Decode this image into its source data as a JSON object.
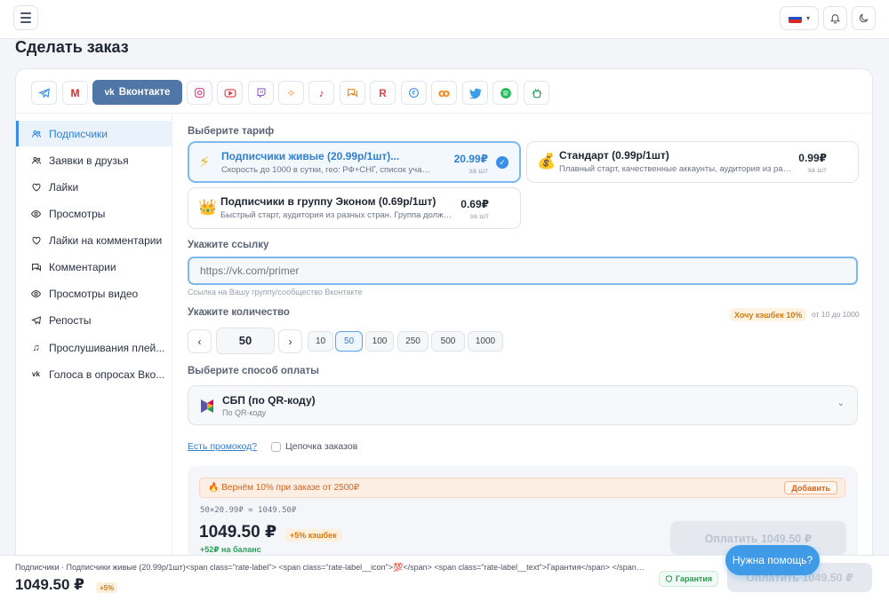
{
  "page": {
    "title": "Сделать заказ"
  },
  "header": {
    "language": "ru",
    "icons": [
      "menu-icon",
      "bell-icon",
      "moon-icon"
    ]
  },
  "platforms": {
    "active_label": "Вконтакте",
    "items": [
      "telegram",
      "gmail",
      "vkontakte",
      "instagram",
      "youtube",
      "twitch",
      "sparkle",
      "tiktok",
      "chat",
      "rutube",
      "threads",
      "odnoklassniki",
      "twitter",
      "spotify",
      "telegram-bot"
    ]
  },
  "sidebar": {
    "items": [
      {
        "label": "Подписчики",
        "icon": "users-icon",
        "active": true
      },
      {
        "label": "Заявки в друзья",
        "icon": "friends-icon"
      },
      {
        "label": "Лайки",
        "icon": "heart-icon"
      },
      {
        "label": "Просмотры",
        "icon": "eye-icon"
      },
      {
        "label": "Лайки на комментарии",
        "icon": "heart-icon"
      },
      {
        "label": "Комментарии",
        "icon": "comment-icon"
      },
      {
        "label": "Просмотры видео",
        "icon": "eye-icon"
      },
      {
        "label": "Репосты",
        "icon": "send-icon"
      },
      {
        "label": "Прослушивания плей...",
        "icon": "music-icon"
      },
      {
        "label": "Голоса в опросах Вко...",
        "icon": "vk-icon"
      }
    ]
  },
  "tariffs": {
    "label": "Выберите тариф",
    "items": [
      {
        "title": "Подписчики живые (20.99р/1шт)...",
        "desc": "Скорость до 1000 в сутки, гео: РФ+СНГ, список участник...",
        "price": "20.99₽",
        "unit": "за шт",
        "icon": "⚡",
        "selected": true
      },
      {
        "title": "Стандарт (0.99р/1шт)",
        "desc": "Плавный старт, качественные аккаунты, аудитория из раз...",
        "price": "0.99₽",
        "unit": "за шт",
        "icon": "💰"
      },
      {
        "title": "Подписчики в группу Эконом (0.69р/1шт)",
        "desc": "Быстрый старт, аудитория из разных стран. Группа должн...",
        "price": "0.69₽",
        "unit": "за шт",
        "icon": "👑"
      }
    ]
  },
  "link": {
    "label": "Укажите ссылку",
    "placeholder": "https://vk.com/primer",
    "hint": "Ссылка на Вашу группу/сообщество Вконтакте"
  },
  "quantity": {
    "label": "Укажите количество",
    "cashback_badge": "Хочу кэшбек 10%",
    "range": "от 10 до 1000",
    "value": "50",
    "dec": "‹",
    "inc": "›",
    "presets": [
      "10",
      "50",
      "100",
      "250",
      "500",
      "1000"
    ],
    "active_preset": "50"
  },
  "payment": {
    "label": "Выберите способ оплаты",
    "method": "СБП (по QR-коду)",
    "sub": "По QR-коду"
  },
  "promo": {
    "link": "Есть промокод?",
    "chain": "Цепочка заказов"
  },
  "summary": {
    "banner": "🔥 Вернём 10% при заказе от 2500₽",
    "banner_button": "Добавить",
    "formula": "50×20.99₽ = 1049.50₽",
    "total": "1049.50 ₽",
    "cashback": "+5% кэшбек",
    "bonus": "+52₽ на баланс",
    "pay_button": "Оплатить 1049.50 ₽"
  },
  "bottombar": {
    "text": "Подписчики · Подписчики живые (20.99р/1шт)<span class=\"rate-label\"> <span class=\"rate-label__icon\">💯</span> <span class=\"rate-label__text\">Гарантия</span> </span> · за шт",
    "total": "1049.50 ₽",
    "cashback": "+5%",
    "guarantee": "Гарантия",
    "pay_button": "Оплатить 1049.50 ₽"
  },
  "help": {
    "label": "Нужна помощь?"
  },
  "colors": {
    "accent": "#3a8ee6",
    "vk": "#4f76a6",
    "orange": "#d0651d",
    "green": "#2a9a55"
  }
}
